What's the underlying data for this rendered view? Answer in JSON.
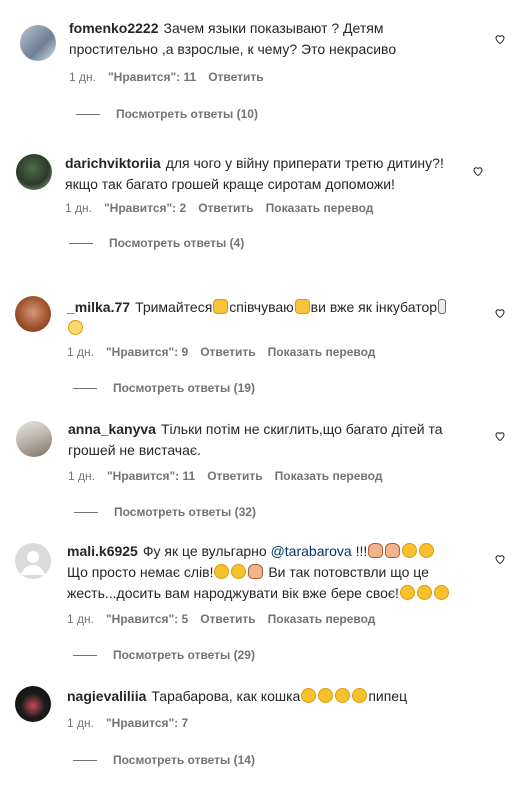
{
  "comments": [
    {
      "username": "fomenko2222",
      "text": "Зачем языки показывают ? Детям простительно ,а взрослые, к чему? Это некрасиво",
      "time": "1 дн.",
      "likes": "\"Нравится\": 11",
      "reply": "Ответить",
      "replies": "Посмотреть ответы (10)"
    },
    {
      "username": "darichviktoriia",
      "text": "для чого у війну приперати третю дитину?! якщо так багато грошей краще сиротам допоможи!",
      "time": "1 дн.",
      "likes": "\"Нравится\": 2",
      "reply": "Ответить",
      "translate": "Показать перевод",
      "replies": "Посмотреть ответы (4)"
    },
    {
      "username": "_milka.77",
      "text_a": "Тримайтеся",
      "text_b": "співчуваю",
      "text_c": "ви вже як інкубатор",
      "time": "1 дн.",
      "likes": "\"Нравится\": 9",
      "reply": "Ответить",
      "translate": "Показать перевод",
      "replies": "Посмотреть ответы (19)"
    },
    {
      "username": "anna_kanyva",
      "text": "Тільки потім не скиглить,що багато дітей та грошей не вистачає.",
      "time": "1 дн.",
      "likes": "\"Нравится\": 11",
      "reply": "Ответить",
      "translate": "Показать перевод",
      "replies": "Посмотреть ответы (32)"
    },
    {
      "username": "mali.k6925",
      "text_a": "Фу як це вульгарно",
      "mention": "@tarabarova",
      "text_b": "!!!",
      "text_c": "Що просто немає слів!",
      "text_d": "Ви так потовствли що це жесть...досить вам народжувати вік вже бере своє!",
      "time": "1 дн.",
      "likes": "\"Нравится\": 5",
      "reply": "Ответить",
      "translate": "Показать перевод",
      "replies": "Посмотреть ответы (29)"
    },
    {
      "username": "nagievaliliia",
      "text_a": "Тарабарова, как кошка",
      "text_b": "пипец",
      "time": "1 дн.",
      "likes": "\"Нравится\": 7",
      "reply": "Ответить",
      "replies": "Посмотреть ответы (14)"
    }
  ]
}
